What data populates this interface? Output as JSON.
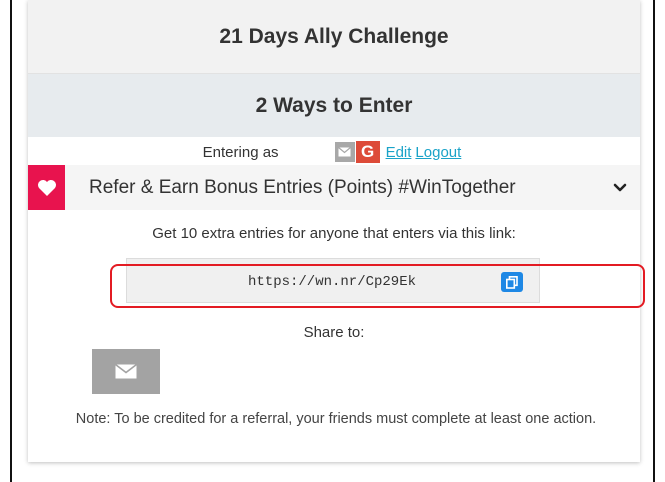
{
  "header": {
    "title": "21 Days Ally Challenge"
  },
  "ways": {
    "title": "2 Ways to Enter"
  },
  "entering": {
    "label": "Entering as",
    "google_letter": "G",
    "edit_label": "Edit",
    "logout_label": "Logout"
  },
  "action": {
    "title": "Refer & Earn Bonus Entries (Points) #WinTogether",
    "description": "Get 10 extra entries for anyone that enters via this link:",
    "referral_url": "https://wn.nr/Cp29Ek",
    "share_label": "Share to:",
    "note": "Note: To be credited for a referral, your friends must complete at least one action."
  },
  "icons": {
    "heart": "heart-icon",
    "chevron": "chevron-down-icon",
    "copy": "copy-icon",
    "email": "envelope-icon"
  },
  "colors": {
    "heart_bg": "#e8134e",
    "google_red": "#dd4b39",
    "link": "#1aa3c8",
    "copy_button": "#1e88e5",
    "highlight": "#e31b23"
  }
}
